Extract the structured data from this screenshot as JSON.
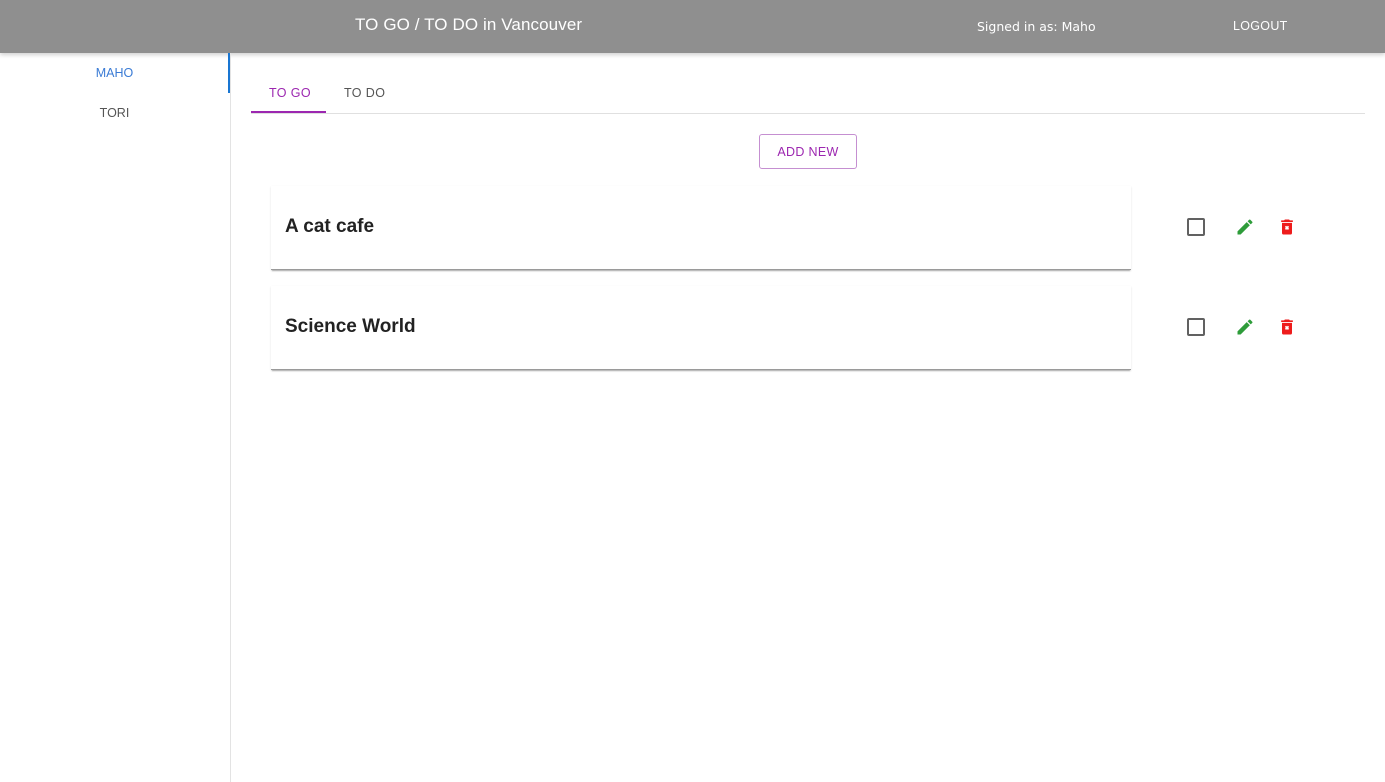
{
  "header": {
    "title": "TO GO / TO DO in Vancouver",
    "signed_in": "Signed in as: Maho",
    "logout_label": "LOGOUT"
  },
  "sidebar": {
    "items": [
      {
        "label": "MAHO",
        "active": true
      },
      {
        "label": "TORI",
        "active": false
      }
    ]
  },
  "tabs": [
    {
      "label": "TO GO",
      "active": true
    },
    {
      "label": "TO DO",
      "active": false
    }
  ],
  "add_button_label": "ADD NEW",
  "items": [
    {
      "title": "A cat cafe",
      "checked": false,
      "icons": [
        "checkbox-icon",
        "pencil-icon",
        "trash-icon"
      ]
    },
    {
      "title": "Science World",
      "checked": false,
      "icons": [
        "checkbox-icon",
        "pencil-icon",
        "trash-icon"
      ]
    }
  ],
  "colors": {
    "appbar": "#8f8f8f",
    "accent": "#9c27b0",
    "sidebar_active": "#3a7bd5",
    "edit_icon": "#2e9c3a",
    "delete_icon": "#ee1c1c"
  }
}
